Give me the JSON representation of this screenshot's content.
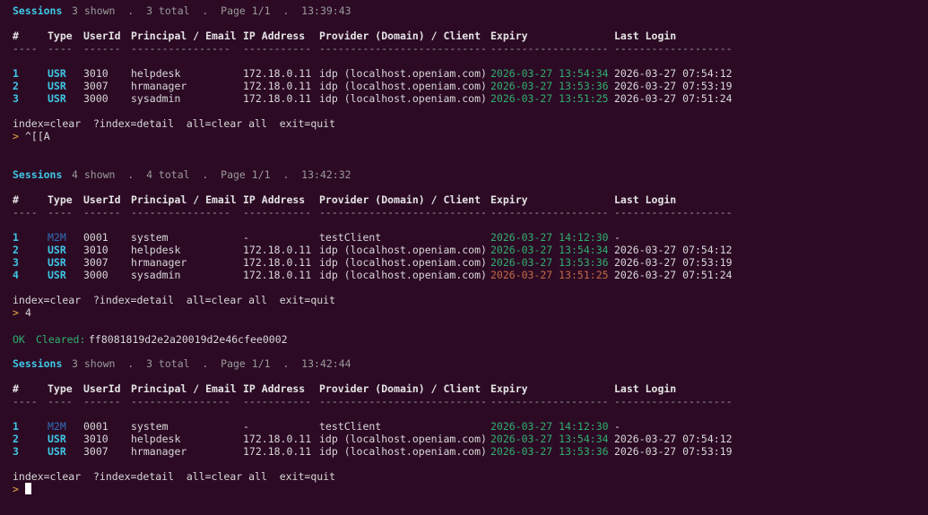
{
  "columns": [
    "#",
    "Type",
    "UserId",
    "Principal / Email",
    "IP Address",
    "Provider (Domain) / Client",
    "Expiry",
    "Last Login"
  ],
  "separators": [
    "----",
    "----",
    "------",
    "----------------",
    "-----------",
    "---------------------------",
    "-------------------",
    "-------------------"
  ],
  "help_text": "index=clear  ?index=detail  all=clear all  exit=quit",
  "prompt_symbol": ">",
  "blocks": [
    {
      "title": "Sessions",
      "info": "3 shown  .  3 total  .  Page 1/1  .  13:39:43",
      "rows": [
        {
          "idx": "1",
          "type": "USR",
          "userid": "3010",
          "principal": "helpdesk",
          "ip": "172.18.0.11",
          "provider": "idp (localhost.openiam.com)",
          "expiry": "2026-03-27 13:54:34",
          "last_login": "2026-03-27 07:54:12",
          "expiry_status": "ok"
        },
        {
          "idx": "2",
          "type": "USR",
          "userid": "3007",
          "principal": "hrmanager",
          "ip": "172.18.0.11",
          "provider": "idp (localhost.openiam.com)",
          "expiry": "2026-03-27 13:53:36",
          "last_login": "2026-03-27 07:53:19",
          "expiry_status": "ok"
        },
        {
          "idx": "3",
          "type": "USR",
          "userid": "3000",
          "principal": "sysadmin",
          "ip": "172.18.0.11",
          "provider": "idp (localhost.openiam.com)",
          "expiry": "2026-03-27 13:51:25",
          "last_login": "2026-03-27 07:51:24",
          "expiry_status": "ok"
        }
      ],
      "input": "^[[A"
    },
    {
      "title": "Sessions",
      "info": "4 shown  .  4 total  .  Page 1/1  .  13:42:32",
      "rows": [
        {
          "idx": "1",
          "type": "M2M",
          "userid": "0001",
          "principal": "system",
          "ip": "-",
          "provider": "testClient",
          "expiry": "2026-03-27 14:12:30",
          "last_login": "-",
          "expiry_status": "ok"
        },
        {
          "idx": "2",
          "type": "USR",
          "userid": "3010",
          "principal": "helpdesk",
          "ip": "172.18.0.11",
          "provider": "idp (localhost.openiam.com)",
          "expiry": "2026-03-27 13:54:34",
          "last_login": "2026-03-27 07:54:12",
          "expiry_status": "ok"
        },
        {
          "idx": "3",
          "type": "USR",
          "userid": "3007",
          "principal": "hrmanager",
          "ip": "172.18.0.11",
          "provider": "idp (localhost.openiam.com)",
          "expiry": "2026-03-27 13:53:36",
          "last_login": "2026-03-27 07:53:19",
          "expiry_status": "ok"
        },
        {
          "idx": "4",
          "type": "USR",
          "userid": "3000",
          "principal": "sysadmin",
          "ip": "172.18.0.11",
          "provider": "idp (localhost.openiam.com)",
          "expiry": "2026-03-27 13:51:25",
          "last_login": "2026-03-27 07:51:24",
          "expiry_status": "expired"
        }
      ],
      "input": "4"
    },
    {
      "title": "Sessions",
      "info": "3 shown  .  3 total  .  Page 1/1  .  13:42:44",
      "rows": [
        {
          "idx": "1",
          "type": "M2M",
          "userid": "0001",
          "principal": "system",
          "ip": "-",
          "provider": "testClient",
          "expiry": "2026-03-27 14:12:30",
          "last_login": "-",
          "expiry_status": "ok"
        },
        {
          "idx": "2",
          "type": "USR",
          "userid": "3010",
          "principal": "helpdesk",
          "ip": "172.18.0.11",
          "provider": "idp (localhost.openiam.com)",
          "expiry": "2026-03-27 13:54:34",
          "last_login": "2026-03-27 07:54:12",
          "expiry_status": "ok"
        },
        {
          "idx": "3",
          "type": "USR",
          "userid": "3007",
          "principal": "hrmanager",
          "ip": "172.18.0.11",
          "provider": "idp (localhost.openiam.com)",
          "expiry": "2026-03-27 13:53:36",
          "last_login": "2026-03-27 07:53:19",
          "expiry_status": "ok"
        }
      ],
      "input": ""
    }
  ],
  "ok_message": {
    "status": "OK",
    "label": "Cleared:",
    "id": "ff8081819d2e2a20019d2e46cfee0002"
  },
  "colors": {
    "background": "#2c0a24",
    "title": "#3ec7e6",
    "expiry_ok": "#30b070",
    "expiry_expired": "#c46a46",
    "type_m2m": "#2f6fb8",
    "type_usr": "#3ec7e6",
    "prompt": "#e8b040"
  }
}
